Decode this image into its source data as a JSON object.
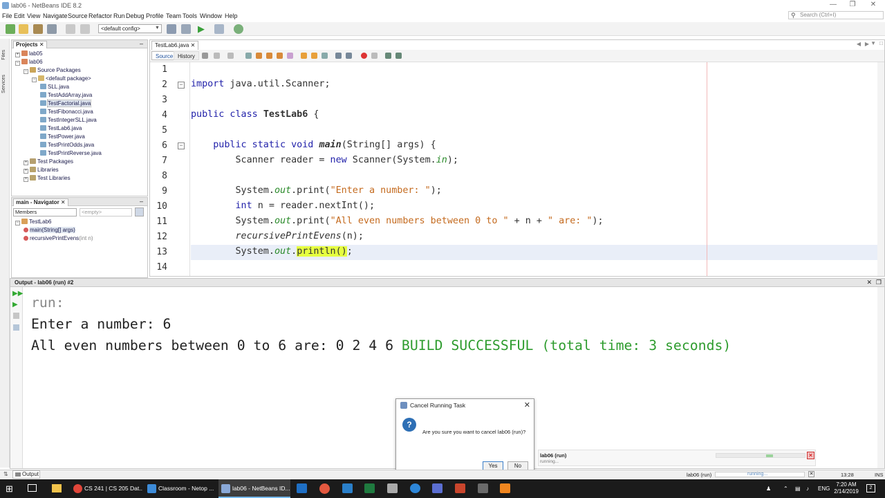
{
  "window": {
    "title": "lab06 - NetBeans IDE 8.2",
    "search_placeholder": "Search (Ctrl+I)"
  },
  "menu": [
    "File",
    "Edit",
    "View",
    "Navigate",
    "Source",
    "Refactor",
    "Run",
    "Debug",
    "Profile",
    "Team",
    "Tools",
    "Window",
    "Help"
  ],
  "toolbar": {
    "config": "<default config>"
  },
  "projects": {
    "tab": "Projects",
    "items": [
      {
        "label": "lab05",
        "level": 0,
        "icon": "project-icon"
      },
      {
        "label": "lab06",
        "level": 0,
        "icon": "project-icon"
      },
      {
        "label": "Source Packages",
        "level": 1,
        "icon": "source-folder-icon"
      },
      {
        "label": "<default package>",
        "level": 2,
        "icon": "package-icon"
      },
      {
        "label": "SLL.java",
        "level": 3,
        "icon": "java-file-icon"
      },
      {
        "label": "TestAddArray.java",
        "level": 3,
        "icon": "java-file-icon"
      },
      {
        "label": "TestFactorial.java",
        "level": 3,
        "icon": "java-file-icon",
        "selected": true
      },
      {
        "label": "TestFibonacci.java",
        "level": 3,
        "icon": "java-file-icon"
      },
      {
        "label": "TestIntegerSLL.java",
        "level": 3,
        "icon": "java-file-icon"
      },
      {
        "label": "TestLab6.java",
        "level": 3,
        "icon": "java-file-icon"
      },
      {
        "label": "TestPower.java",
        "level": 3,
        "icon": "java-file-icon"
      },
      {
        "label": "TestPrintOdds.java",
        "level": 3,
        "icon": "java-file-icon"
      },
      {
        "label": "TestPrintReverse.java",
        "level": 3,
        "icon": "java-file-icon"
      },
      {
        "label": "Test Packages",
        "level": 1,
        "icon": "test-folder-icon"
      },
      {
        "label": "Libraries",
        "level": 1,
        "icon": "library-icon"
      },
      {
        "label": "Test Libraries",
        "level": 1,
        "icon": "library-icon"
      }
    ]
  },
  "navigator": {
    "tab": "main - Navigator",
    "members_label": "Members",
    "filter_placeholder": "<empty>",
    "items": [
      {
        "label": "TestLab6",
        "level": 0
      },
      {
        "label": "main(String[] args)",
        "level": 1
      },
      {
        "label": "recursivePrintEvens",
        "suffix": "(int n)",
        "level": 1
      }
    ]
  },
  "editor": {
    "tab": "TestLab6.java",
    "source_label": "Source",
    "history_label": "History",
    "line_numbers": [
      "1",
      "2",
      "3",
      "4",
      "5",
      "6",
      "7",
      "8",
      "9",
      "10",
      "11",
      "12",
      "13",
      "14"
    ]
  },
  "output": {
    "title": "Output - lab06 (run) #2",
    "lines": {
      "run": "run:",
      "prompt": "Enter a number: 6",
      "result": "All even numbers between 0 to 6 are: 0 2 4 6 ",
      "build": "BUILD SUCCESSFUL (total time: 3 seconds)"
    }
  },
  "dialog": {
    "title": "Cancel Running Task",
    "message": "Are you sure you want to cancel lab06 (run)?",
    "yes": "Yes",
    "no": "No"
  },
  "progress": {
    "task": "lab06 (run)",
    "status": "running..."
  },
  "statusbar": {
    "output_tab": "Output",
    "task": "lab06 (run)",
    "status": "running...",
    "position": "13:28",
    "mode": "INS"
  },
  "taskbar": {
    "apps": [
      {
        "label": "CS 241 | CS 205 Dat...",
        "icon": "chrome-icon"
      },
      {
        "label": "Classroom - Netop ...",
        "icon": "classroom-icon"
      },
      {
        "label": "lab06 - NetBeans ID...",
        "icon": "netbeans-icon",
        "active": true
      }
    ],
    "lang": "ENG",
    "time": "7:20 AM",
    "date": "2/14/2019",
    "notifications": "2"
  },
  "colors": {
    "keyword": "#2222aa",
    "string": "#c46a1e",
    "success": "#2e9c2e",
    "highlight": "#e6ff40"
  }
}
